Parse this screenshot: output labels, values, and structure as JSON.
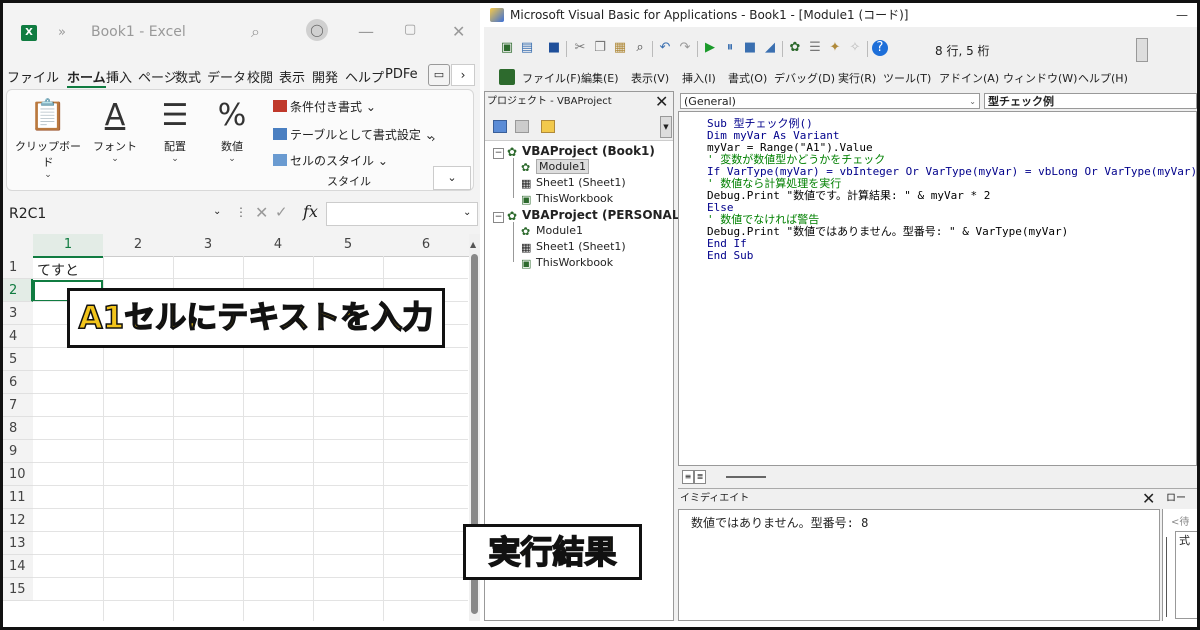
{
  "excel": {
    "app_icon": "X",
    "title": "Book1 - Excel",
    "window_buttons": {
      "minimize": "—",
      "maximize": "▢",
      "close": "✕"
    },
    "tabs": [
      "ファイル",
      "ホーム",
      "挿入",
      "ページ",
      "数式",
      "データ",
      "校閲",
      "表示",
      "開発",
      "ヘルプ",
      "PDFe"
    ],
    "active_tab": "ホーム",
    "ribbon": {
      "clipboard": "クリップボード",
      "font": "フォント",
      "alignment": "配置",
      "number": "数値",
      "number_icon": "%",
      "conditional_format": "条件付き書式",
      "format_as_table": "テーブルとして書式設定",
      "cell_styles": "セルのスタイル",
      "styles_group": "スタイル"
    },
    "name_box": "R2C1",
    "fx": "fx",
    "columns": [
      "1",
      "2",
      "3",
      "4",
      "5",
      "6"
    ],
    "rows": [
      "1",
      "2",
      "3",
      "4",
      "5",
      "6",
      "7",
      "8",
      "9",
      "10",
      "11",
      "12",
      "13",
      "14",
      "15"
    ],
    "cell_r1c1": "てすと",
    "active_column": "1",
    "active_row": "2"
  },
  "annotations": {
    "input_banner": "A1セルにテキストを入力",
    "result_banner": "実行結果"
  },
  "vba": {
    "title": "Microsoft Visual Basic for Applications - Book1 - [Module1 (コード)]",
    "minimize": "—",
    "position": "8 行, 5 桁",
    "menu": [
      "ファイル(F)",
      "編集(E)",
      "表示(V)",
      "挿入(I)",
      "書式(O)",
      "デバッグ(D)",
      "実行(R)",
      "ツール(T)",
      "アドイン(A)",
      "ウィンドウ(W)",
      "ヘルプ(H)"
    ],
    "project_title": "プロジェクト - VBAProject",
    "tree": {
      "project1": "VBAProject (Book1)",
      "p1_module": "Module1",
      "p1_sheet": "Sheet1 (Sheet1)",
      "p1_workbook": "ThisWorkbook",
      "project2": "VBAProject (PERSONAL.",
      "p2_module": "Module1",
      "p2_sheet": "Sheet1 (Sheet1)",
      "p2_workbook": "ThisWorkbook"
    },
    "object_combo": "(General)",
    "proc_combo": "型チェック例",
    "code_lines": [
      "Sub 型チェック例()",
      "Dim myVar As Variant",
      "myVar = Range(\"A1\").Value",
      "' 変数が数値型かどうかをチェック",
      "If VarType(myVar) = vbInteger Or VarType(myVar) = vbLong Or VarType(myVar)",
      "' 数値なら計算処理を実行",
      "Debug.Print \"数値です。計算結果: \" & myVar * 2",
      "Else",
      "' 数値でなければ警告",
      "Debug.Print \"数値ではありません。型番号: \" & VarType(myVar)",
      "End If",
      "End Sub"
    ],
    "immediate_title": "イミディエイト",
    "immediate_output": "数値ではありません。型番号: 8",
    "locals_title": "ロー",
    "locals_row1": "<待",
    "locals_row2": "式"
  },
  "colors": {
    "excel_green": "#107c41",
    "keyword_blue": "#00008b",
    "comment_green": "#008000",
    "banner_yellow": "#f2c41b"
  }
}
